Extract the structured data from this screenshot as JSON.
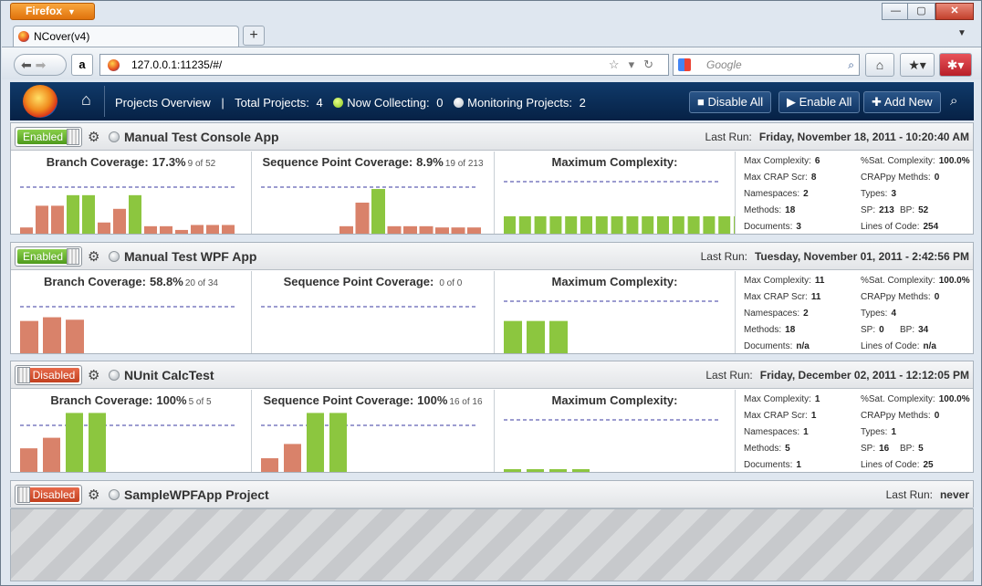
{
  "browser": {
    "menu_label": "Firefox",
    "tab_title": "NCover(v4)",
    "new_tab": "+",
    "url": "127.0.0.1:11235/#/",
    "search_placeholder": "Google",
    "amazon_glyph": "a"
  },
  "app": {
    "nav_title": "Projects Overview",
    "total_label": "Total Projects:",
    "total_value": "4",
    "collecting_label": "Now Collecting:",
    "collecting_value": "0",
    "monitoring_label": "Monitoring Projects:",
    "monitoring_value": "2",
    "disable_all": "Disable All",
    "enable_all": "Enable All",
    "add_new": "Add New"
  },
  "projects": [
    {
      "status": "Enabled",
      "name": "Manual Test Console App",
      "lastrun_label": "Last Run:",
      "lastrun": "Friday, November 18, 2011 - 10:20:40 AM",
      "branch": {
        "label": "Branch Coverage:",
        "pct": "17.3%",
        "detail": "9 of 52",
        "bars": [
          0.1,
          0.45,
          0.45,
          0.62,
          0.62,
          0.18,
          0.4,
          0.62,
          0.12,
          0.12,
          0.06,
          0.14,
          0.14,
          0.14
        ],
        "colors": [
          "o",
          "o",
          "o",
          "g",
          "g",
          "o",
          "o",
          "g",
          "o",
          "o",
          "o",
          "o",
          "o",
          "o"
        ]
      },
      "seq": {
        "label": "Sequence Point Coverage:",
        "pct": "8.9%",
        "detail": "19 of 213",
        "bars": [
          0.12,
          0.5,
          0.72,
          0.12,
          0.12,
          0.12,
          0.1,
          0.1,
          0.1
        ],
        "colors": [
          "o",
          "o",
          "g",
          "o",
          "o",
          "o",
          "o",
          "o",
          "o"
        ],
        "offset": 5
      },
      "cx": {
        "label": "Maximum Complexity:",
        "bars": [
          0.28,
          0.28,
          0.28,
          0.28,
          0.28,
          0.28,
          0.28,
          0.28,
          0.28,
          0.28,
          0.28,
          0.28,
          0.28,
          0.28,
          0.28,
          0.28
        ]
      },
      "stats": {
        "max_complexity": "6",
        "sat_complexity": "100.0%",
        "max_crap": "8",
        "crappy": "0",
        "namespaces": "2",
        "types": "3",
        "methods": "18",
        "sp": "213",
        "bp": "52",
        "documents": "3",
        "loc": "254"
      }
    },
    {
      "status": "Enabled",
      "name": "Manual Test WPF App",
      "lastrun_label": "Last Run:",
      "lastrun": "Tuesday, November 01, 2011 - 2:42:56 PM",
      "branch": {
        "label": "Branch Coverage:",
        "pct": "58.8%",
        "detail": "20 of 34",
        "bars": [
          0.52,
          0.58,
          0.54
        ],
        "colors": [
          "o",
          "o",
          "o"
        ]
      },
      "seq": {
        "label": "Sequence Point Coverage:",
        "pct": "",
        "detail": "0 of 0",
        "bars": [],
        "colors": []
      },
      "cx": {
        "label": "Maximum Complexity:",
        "bars": [
          0.52,
          0.52,
          0.52
        ]
      },
      "stats": {
        "max_complexity": "11",
        "sat_complexity": "100.0%",
        "max_crap": "11",
        "crappy": "0",
        "namespaces": "2",
        "types": "4",
        "methods": "18",
        "sp": "0",
        "bp": "34",
        "documents": "n/a",
        "loc": "n/a"
      }
    },
    {
      "status": "Disabled",
      "name": "NUnit CalcTest",
      "lastrun_label": "Last Run:",
      "lastrun": "Friday, December 02, 2011 - 12:12:05 PM",
      "branch": {
        "label": "Branch Coverage:",
        "pct": "100%",
        "detail": "5 of 5",
        "bars": [
          0.38,
          0.55,
          0.95,
          0.95
        ],
        "colors": [
          "o",
          "o",
          "g",
          "g"
        ]
      },
      "seq": {
        "label": "Sequence Point Coverage:",
        "pct": "100%",
        "detail": "16 of 16",
        "bars": [
          0.22,
          0.45,
          0.95,
          0.95
        ],
        "colors": [
          "o",
          "o",
          "g",
          "g"
        ]
      },
      "cx": {
        "label": "Maximum Complexity:",
        "bars": [
          0.04,
          0.04,
          0.04,
          0.04
        ]
      },
      "stats": {
        "max_complexity": "1",
        "sat_complexity": "100.0%",
        "max_crap": "1",
        "crappy": "0",
        "namespaces": "1",
        "types": "1",
        "methods": "5",
        "sp": "16",
        "bp": "5",
        "documents": "1",
        "loc": "25"
      }
    },
    {
      "status": "Disabled",
      "name": "SampleWPFApp Project",
      "lastrun_label": "Last Run:",
      "lastrun": "never"
    }
  ],
  "stat_labels": {
    "max_complexity": "Max Complexity:",
    "sat_complexity": "%Sat. Complexity:",
    "max_crap": "Max CRAP Scr:",
    "crappy": "CRAPpy Methds:",
    "namespaces": "Namespaces:",
    "types": "Types:",
    "methods": "Methods:",
    "sp": "SP:",
    "bp": "BP:",
    "documents": "Documents:",
    "loc": "Lines of Code:"
  },
  "colors": {
    "green": "#8cc63f",
    "orange": "#d9826a",
    "dash": "#3a3aa0"
  }
}
